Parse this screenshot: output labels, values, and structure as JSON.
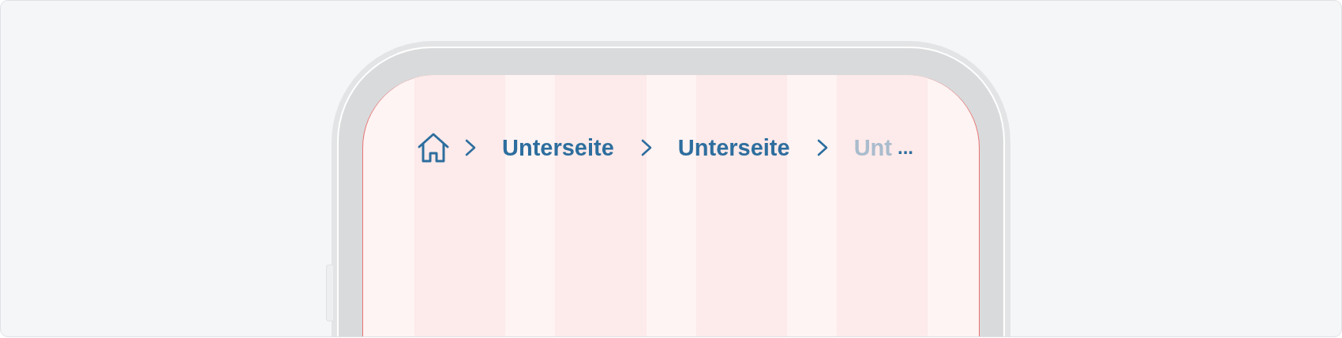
{
  "breadcrumb": {
    "items": [
      {
        "kind": "home"
      },
      {
        "kind": "link",
        "label": "Unterseite"
      },
      {
        "kind": "link",
        "label": "Unterseite"
      },
      {
        "kind": "faded",
        "label": "Unt"
      }
    ],
    "overflow": "..."
  }
}
